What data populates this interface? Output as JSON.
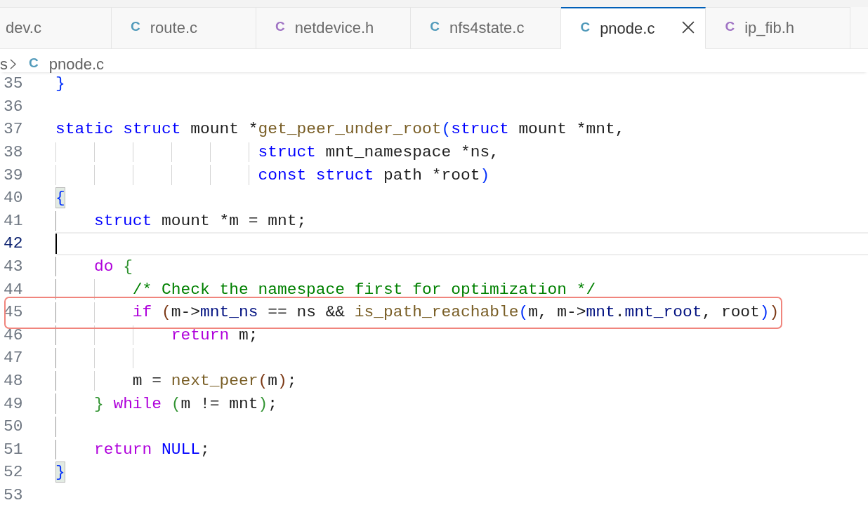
{
  "tabs": [
    {
      "label": "dev.c",
      "selected": false
    },
    {
      "label": "route.c",
      "icon": "C",
      "color": "#519aba",
      "selected": false
    },
    {
      "label": "netdevice.h",
      "icon": "C",
      "color": "#a074c4",
      "selected": false
    },
    {
      "label": "nfs4state.c",
      "icon": "C",
      "color": "#519aba",
      "selected": false
    },
    {
      "label": "pnode.c",
      "icon": "C",
      "color": "#519aba",
      "selected": true
    },
    {
      "label": "ip_fib.h",
      "icon": "C",
      "color": "#a074c4",
      "selected": false
    }
  ],
  "breadcrumb": {
    "items": [
      {
        "label": "s"
      },
      {
        "label": "pnode.c",
        "icon": "C",
        "color": "#519aba"
      }
    ]
  },
  "lines": [
    {
      "number": "35",
      "current": false,
      "boxed": false,
      "tokens": [
        {
          "kind": "paren1",
          "text": "}",
          "matched": false
        }
      ]
    },
    {
      "number": "36",
      "current": false,
      "boxed": false
    },
    {
      "number": "37",
      "current": false,
      "boxed": false,
      "tokens": [
        {
          "kind": "keyword",
          "text": "static "
        },
        {
          "kind": "keyword",
          "text": "struct"
        },
        {
          "kind": "plain",
          "text": " mount *"
        },
        {
          "kind": "function",
          "text": "get_peer_under_root"
        },
        {
          "kind": "paren1",
          "text": "(",
          "matched": false
        },
        {
          "kind": "keyword",
          "text": "struct"
        },
        {
          "kind": "plain",
          "text": " mount *mnt,"
        }
      ]
    },
    {
      "number": "38",
      "current": false,
      "boxed": false,
      "tokens": [
        {
          "kind": "keyword",
          "text": "                     struct"
        },
        {
          "kind": "plain",
          "text": " mnt_namespace *ns,"
        }
      ]
    },
    {
      "number": "39",
      "current": false,
      "boxed": false,
      "tokens": [
        {
          "kind": "keyword",
          "text": "                     const "
        },
        {
          "kind": "keyword",
          "text": "struct"
        },
        {
          "kind": "plain",
          "text": " path *root"
        },
        {
          "kind": "paren1",
          "text": ")",
          "matched": false
        }
      ]
    },
    {
      "number": "40",
      "current": false,
      "boxed": false,
      "tokens": [
        {
          "kind": "paren1",
          "text": "{",
          "matched": true
        }
      ]
    },
    {
      "number": "41",
      "current": false,
      "boxed": false,
      "tokens": [
        {
          "kind": "keyword",
          "text": "    struct"
        },
        {
          "kind": "plain",
          "text": " mount *m = mnt;"
        }
      ]
    },
    {
      "number": "42",
      "current": true,
      "boxed": false
    },
    {
      "number": "43",
      "current": false,
      "boxed": false,
      "tokens": [
        {
          "kind": "control",
          "text": "    do "
        },
        {
          "kind": "paren2",
          "text": "{",
          "matched": false
        }
      ]
    },
    {
      "number": "44",
      "current": false,
      "boxed": false,
      "tokens": [
        {
          "kind": "comment",
          "text": "        /* Check the namespace first for optimization */"
        }
      ]
    },
    {
      "number": "45",
      "current": false,
      "boxed": true,
      "tokens": [
        {
          "kind": "control",
          "text": "        if "
        },
        {
          "kind": "paren3",
          "text": "(",
          "matched": false
        },
        {
          "kind": "plain",
          "text": "m->"
        },
        {
          "kind": "member",
          "text": "mnt_ns"
        },
        {
          "kind": "plain",
          "text": " == ns && "
        },
        {
          "kind": "function",
          "text": "is_path_reachable"
        },
        {
          "kind": "paren1",
          "text": "(",
          "matched": false
        },
        {
          "kind": "plain",
          "text": "m, m->"
        },
        {
          "kind": "member",
          "text": "mnt"
        },
        {
          "kind": "plain",
          "text": "."
        },
        {
          "kind": "member",
          "text": "mnt_root"
        },
        {
          "kind": "plain",
          "text": ", root"
        },
        {
          "kind": "paren1",
          "text": ")",
          "matched": false
        },
        {
          "kind": "paren3",
          "text": ")",
          "matched": false
        }
      ]
    },
    {
      "number": "46",
      "current": false,
      "boxed": false,
      "tokens": [
        {
          "kind": "control",
          "text": "            return"
        },
        {
          "kind": "plain",
          "text": " m;"
        }
      ]
    },
    {
      "number": "47",
      "current": false,
      "boxed": false
    },
    {
      "number": "48",
      "current": false,
      "boxed": false,
      "tokens": [
        {
          "kind": "plain",
          "text": "        m = "
        },
        {
          "kind": "function",
          "text": "next_peer"
        },
        {
          "kind": "paren3",
          "text": "(",
          "matched": false
        },
        {
          "kind": "plain",
          "text": "m"
        },
        {
          "kind": "paren3",
          "text": ")",
          "matched": false
        },
        {
          "kind": "plain",
          "text": ";"
        }
      ]
    },
    {
      "number": "49",
      "current": false,
      "boxed": false,
      "tokens": [
        {
          "kind": "paren2",
          "text": "    } ",
          "matched": false
        },
        {
          "kind": "control",
          "text": "while "
        },
        {
          "kind": "paren2",
          "text": "(",
          "matched": false
        },
        {
          "kind": "plain",
          "text": "m != mnt"
        },
        {
          "kind": "paren2",
          "text": ")",
          "matched": false
        },
        {
          "kind": "plain",
          "text": ";"
        }
      ]
    },
    {
      "number": "50",
      "current": false,
      "boxed": false
    },
    {
      "number": "51",
      "current": false,
      "boxed": false,
      "tokens": [
        {
          "kind": "control",
          "text": "    return "
        },
        {
          "kind": "constant",
          "text": "NULL"
        },
        {
          "kind": "plain",
          "text": ";"
        }
      ]
    },
    {
      "number": "52",
      "current": false,
      "boxed": false,
      "tokens": [
        {
          "kind": "paren1",
          "text": "}",
          "matched": true
        }
      ]
    },
    {
      "number": "53",
      "current": false,
      "boxed": false
    }
  ]
}
